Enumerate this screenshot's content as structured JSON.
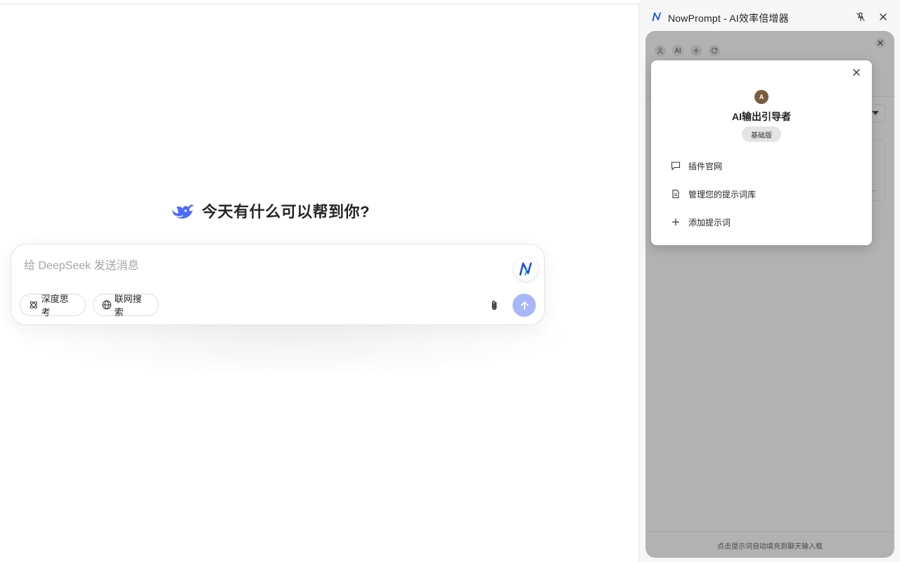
{
  "chat": {
    "welcome_text": "今天有什么可以帮到你?",
    "input_placeholder": "给 DeepSeek 发送消息",
    "deep_think_label": "深度思考",
    "web_search_label": "联网搜索",
    "accent_color": "#4d6bfe",
    "send_button_color": "#a9b7f8"
  },
  "sidepanel": {
    "title": "NowPrompt - AI效率倍增器",
    "toolbar": {
      "ai_label": "AI"
    },
    "footer_text": "点击提示词自动填充到聊天输入框",
    "overlay_color": "#b2b2b2"
  },
  "popup": {
    "avatar_letter": "A",
    "avatar_color": "#7a5c3e",
    "user_name": "AI输出引导者",
    "plan_badge": "基础版",
    "menu": [
      {
        "label": "插件官网",
        "icon": "message-square-icon"
      },
      {
        "label": "管理您的提示词库",
        "icon": "document-icon"
      },
      {
        "label": "添加提示词",
        "icon": "plus-icon"
      }
    ]
  }
}
